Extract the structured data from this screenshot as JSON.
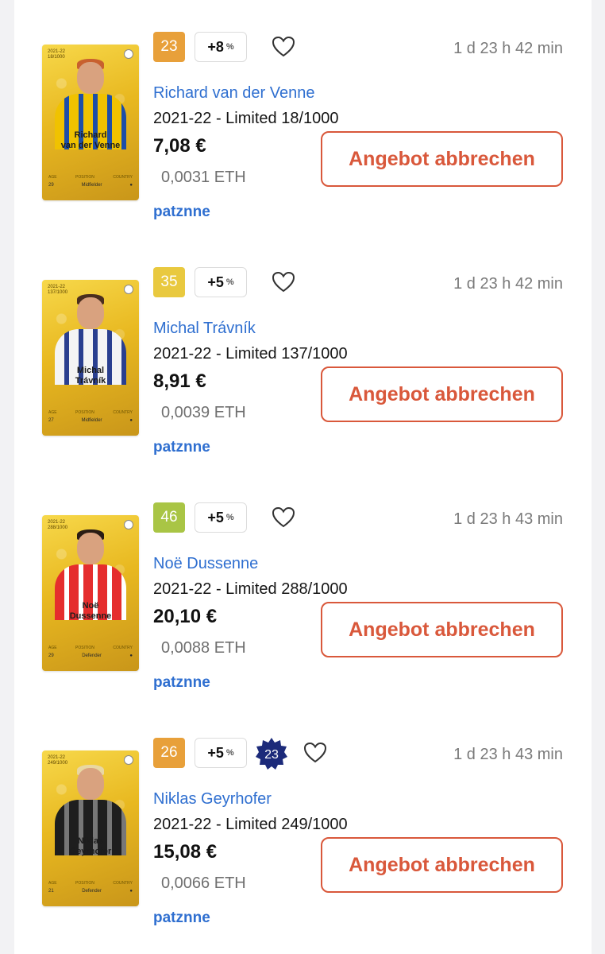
{
  "listings": [
    {
      "card": {
        "season_serial": "2021-22\n18/1000",
        "name": "Richard\nvan der Venne",
        "stat_labels": [
          "AGE",
          "POSITION",
          "COUNTRY"
        ],
        "age": "29",
        "position": "Midfielder",
        "shirt_color": "#f0c200",
        "hair_color": "#c8602e",
        "stripe_color": "#1d4ea8"
      },
      "score": "23",
      "score_color": "#e8a03a",
      "bonus": "+8",
      "bonus_unit": "%",
      "badge": null,
      "timer": "1 d 23 h 42 min",
      "player_name": "Richard van der Venne",
      "edition": "2021-22 - Limited 18/1000",
      "price": "7,08 €",
      "eth": "0,0031 ETH",
      "seller": "patznne",
      "cancel_label": "Angebot abbrechen"
    },
    {
      "card": {
        "season_serial": "2021-22\n137/1000",
        "name": "Michal\nTrávník",
        "stat_labels": [
          "AGE",
          "POSITION",
          "COUNTRY"
        ],
        "age": "27",
        "position": "Midfielder",
        "shirt_color": "#f4f4f4",
        "hair_color": "#4a2e1e",
        "stripe_color": "#2a3f8f"
      },
      "score": "35",
      "score_color": "#e9c93f",
      "bonus": "+5",
      "bonus_unit": "%",
      "badge": null,
      "timer": "1 d 23 h 42 min",
      "player_name": "Michal Trávník",
      "edition": "2021-22 - Limited 137/1000",
      "price": "8,91 €",
      "eth": "0,0039 ETH",
      "seller": "patznne",
      "cancel_label": "Angebot abbrechen"
    },
    {
      "card": {
        "season_serial": "2021-22\n288/1000",
        "name": "Noë\nDussenne",
        "stat_labels": [
          "AGE",
          "POSITION",
          "COUNTRY"
        ],
        "age": "29",
        "position": "Defender",
        "shirt_color": "#e52d2d",
        "hair_color": "#2a1c14",
        "stripe_color": "#ffffff"
      },
      "score": "46",
      "score_color": "#a9c545",
      "bonus": "+5",
      "bonus_unit": "%",
      "badge": null,
      "timer": "1 d 23 h 43 min",
      "player_name": "Noë Dussenne",
      "edition": "2021-22 - Limited 288/1000",
      "price": "20,10 €",
      "eth": "0,0088 ETH",
      "seller": "patznne",
      "cancel_label": "Angebot abbrechen"
    },
    {
      "card": {
        "season_serial": "2021-22\n249/1000",
        "name": "Niklas\nGeyrhofer",
        "stat_labels": [
          "AGE",
          "POSITION",
          "COUNTRY"
        ],
        "age": "21",
        "position": "Defender",
        "shirt_color": "#1e1e1e",
        "hair_color": "#e9d7a2",
        "stripe_color": "#777777"
      },
      "score": "26",
      "score_color": "#e8a03a",
      "bonus": "+5",
      "bonus_unit": "%",
      "badge": "23",
      "timer": "1 d 23 h 43 min",
      "player_name": "Niklas Geyrhofer",
      "edition": "2021-22 - Limited 249/1000",
      "price": "15,08 €",
      "eth": "0,0066 ETH",
      "seller": "patznne",
      "cancel_label": "Angebot abbrechen"
    }
  ],
  "colors": {
    "accent_link": "#2f6fd0",
    "cancel": "#d9583b",
    "badge_navy": "#1c2a7a"
  },
  "icons": {
    "favorite": "heart-icon",
    "badge": "star-badge-icon"
  }
}
